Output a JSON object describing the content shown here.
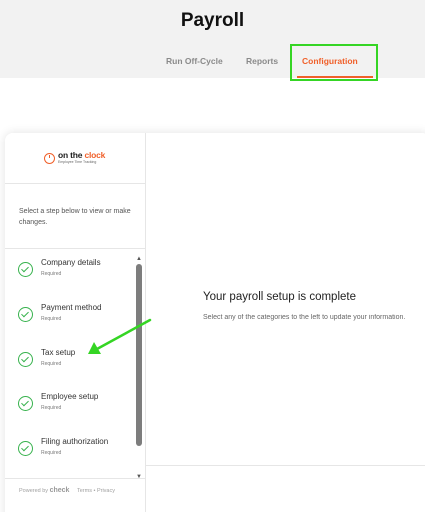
{
  "header": {
    "title": "Payroll",
    "tabs": [
      {
        "label": "Run Off-Cycle"
      },
      {
        "label": "Reports"
      },
      {
        "label": "Configuration",
        "active": true
      }
    ]
  },
  "sidebar": {
    "logo": {
      "main_prefix": "on the ",
      "main_accent": "clock",
      "sub": "Employee Time Tracking"
    },
    "instructions": "Select a step below to view or make changes.",
    "steps": [
      {
        "label": "Company details",
        "status": "Required"
      },
      {
        "label": "Payment method",
        "status": "Required"
      },
      {
        "label": "Tax setup",
        "status": "Required"
      },
      {
        "label": "Employee setup",
        "status": "Required"
      },
      {
        "label": "Filing authorization",
        "status": "Required"
      }
    ],
    "footer": {
      "powered": "Powered by",
      "brand": "check",
      "terms": "Terms",
      "sep": "•",
      "privacy": "Privacy"
    }
  },
  "main": {
    "title": "Your payroll setup is complete",
    "text": "Select any of the categories to the left to update your information."
  },
  "colors": {
    "accent": "#f0602a",
    "highlight": "#35d524",
    "check": "#37b24d",
    "arrow": "#35d524"
  }
}
